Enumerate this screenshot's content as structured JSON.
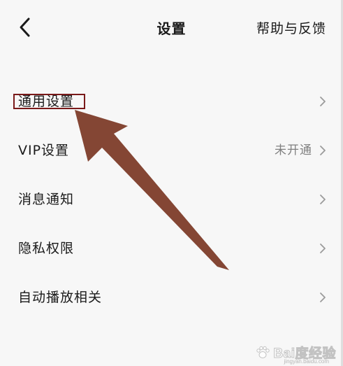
{
  "header": {
    "title": "设置",
    "help_label": "帮助与反馈",
    "back_icon": "chevron-left-icon"
  },
  "settings": {
    "items": [
      {
        "label": "通用设置",
        "value": "",
        "icon": "chevron-right-icon"
      },
      {
        "label": "VIP设置",
        "value": "未开通",
        "icon": "chevron-right-icon"
      },
      {
        "label": "消息通知",
        "value": "",
        "icon": "chevron-right-icon"
      },
      {
        "label": "隐私权限",
        "value": "",
        "icon": "chevron-right-icon"
      },
      {
        "label": "自动播放相关",
        "value": "",
        "icon": "chevron-right-icon"
      }
    ]
  },
  "annotation": {
    "highlight_color": "#7a1a1a",
    "arrow_color": "#7f3e2c"
  },
  "watermark": {
    "text": "Bai度经验",
    "subtext": "jingyan.baidu.com"
  },
  "colors": {
    "background": "#f7f7f7",
    "text": "#1a1a1a",
    "secondary_text": "#808080",
    "chevron": "#9a9a9a"
  }
}
